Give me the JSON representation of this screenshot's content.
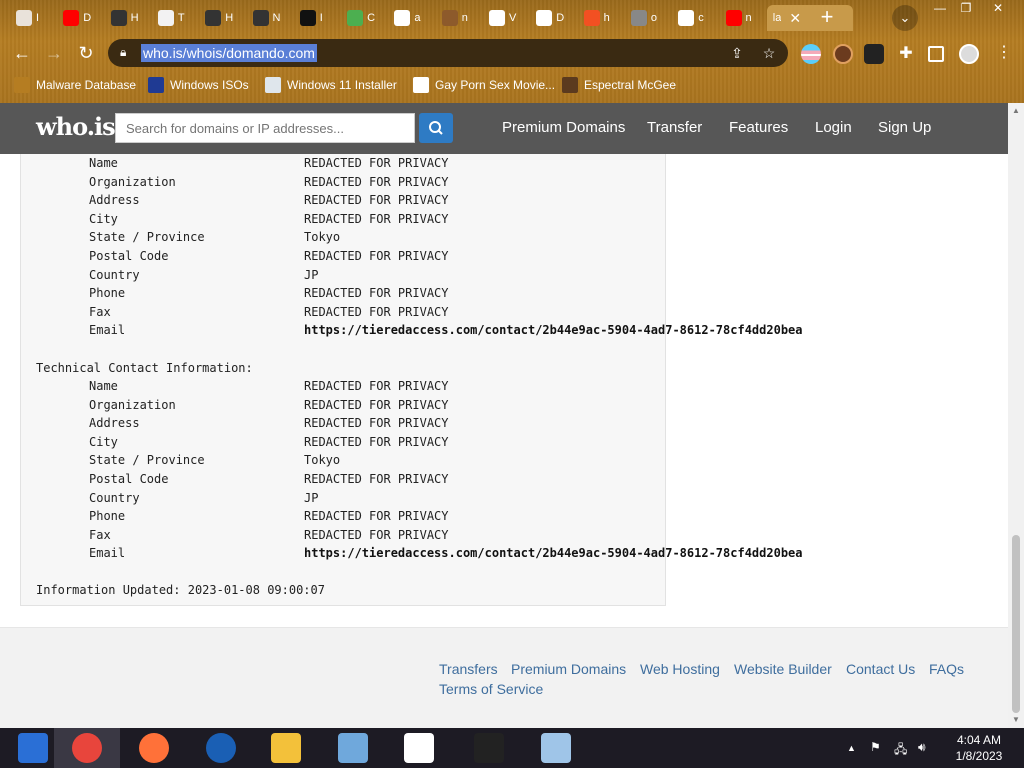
{
  "browser": {
    "tabs": [
      {
        "title": "I",
        "icon": "anime-face-icon",
        "color": "#e9e2da"
      },
      {
        "title": "D",
        "icon": "youtube-icon",
        "color": "#ff0000"
      },
      {
        "title": "H",
        "icon": "glasses-icon",
        "color": "#333333"
      },
      {
        "title": "T",
        "icon": "photo-icon",
        "color": "#f2f2f2"
      },
      {
        "title": "H",
        "icon": "glasses-icon",
        "color": "#333333"
      },
      {
        "title": "N",
        "icon": "glasses-icon",
        "color": "#333333"
      },
      {
        "title": "I",
        "icon": "ip-icon",
        "color": "#111111"
      },
      {
        "title": "C",
        "icon": "pinwheel-icon",
        "color": "#4caf50"
      },
      {
        "title": "a",
        "icon": "globe-icon",
        "color": "#ffffff"
      },
      {
        "title": "n",
        "icon": "monkey-icon",
        "color": "#8d5a2b"
      },
      {
        "title": "V",
        "icon": "museum-icon",
        "color": "#ffffff"
      },
      {
        "title": "D",
        "icon": "v8-icon",
        "color": "#ffffff"
      },
      {
        "title": "h",
        "icon": "microsoft-icon",
        "color": "#f25022"
      },
      {
        "title": "o",
        "icon": "ring-icon",
        "color": "#888888"
      },
      {
        "title": "c",
        "icon": "wikipedia-icon",
        "color": "#ffffff"
      },
      {
        "title": "n",
        "icon": "youtube-icon",
        "color": "#ff0000"
      }
    ],
    "active_tab": {
      "title": "la",
      "icon": "blank-icon"
    },
    "url": "who.is/whois/domando.com",
    "bookmarks": [
      {
        "label": "Malware Database",
        "icon": "bug-icon",
        "color": "#b57d22"
      },
      {
        "label": "Windows ISOs",
        "icon": "x-icon",
        "color": "#1f3a93"
      },
      {
        "label": "Windows 11 Installer",
        "icon": "image-icon",
        "color": "#dfe6ec"
      },
      {
        "label": "Gay Porn Sex Movie...",
        "icon": "python-icon",
        "color": "#ffffff"
      },
      {
        "label": "Espectral McGee",
        "icon": "face-icon",
        "color": "#5b3a1e"
      }
    ],
    "window": {
      "minimize": "—",
      "restore": "❐",
      "close": "✕"
    }
  },
  "site": {
    "logo": "who.is",
    "search_placeholder": "Search for domains or IP addresses...",
    "nav": [
      "Premium Domains",
      "Transfer",
      "Features",
      "Login",
      "Sign Up"
    ],
    "colors": {
      "header": "#575757",
      "accent": "#2e7bc4",
      "link": "#3f6e9e"
    }
  },
  "whois": {
    "registrant_rows": [
      {
        "label": "Name",
        "value": "REDACTED FOR PRIVACY"
      },
      {
        "label": "Organization",
        "value": "REDACTED FOR PRIVACY"
      },
      {
        "label": "Address",
        "value": "REDACTED FOR PRIVACY"
      },
      {
        "label": "City",
        "value": "REDACTED FOR PRIVACY"
      },
      {
        "label": "State / Province",
        "value": "Tokyo"
      },
      {
        "label": "Postal Code",
        "value": "REDACTED FOR PRIVACY"
      },
      {
        "label": "Country",
        "value": "JP"
      },
      {
        "label": "Phone",
        "value": "REDACTED FOR PRIVACY"
      },
      {
        "label": "Fax",
        "value": "REDACTED FOR PRIVACY"
      },
      {
        "label": "Email",
        "value": "https://tieredaccess.com/contact/2b44e9ac-5904-4ad7-8612-78cf4dd20bea"
      }
    ],
    "technical_heading": "Technical Contact Information:",
    "technical_rows": [
      {
        "label": "Name",
        "value": "REDACTED FOR PRIVACY"
      },
      {
        "label": "Organization",
        "value": "REDACTED FOR PRIVACY"
      },
      {
        "label": "Address",
        "value": "REDACTED FOR PRIVACY"
      },
      {
        "label": "City",
        "value": "REDACTED FOR PRIVACY"
      },
      {
        "label": "State / Province",
        "value": "Tokyo"
      },
      {
        "label": "Postal Code",
        "value": "REDACTED FOR PRIVACY"
      },
      {
        "label": "Country",
        "value": "JP"
      },
      {
        "label": "Phone",
        "value": "REDACTED FOR PRIVACY"
      },
      {
        "label": "Fax",
        "value": "REDACTED FOR PRIVACY"
      },
      {
        "label": "Email",
        "value": "https://tieredaccess.com/contact/2b44e9ac-5904-4ad7-8612-78cf4dd20bea"
      }
    ],
    "updated": "Information Updated: 2023-01-08 09:00:07"
  },
  "footer": {
    "links": [
      "Transfers",
      "Premium Domains",
      "Web Hosting",
      "Website Builder",
      "Contact Us",
      "FAQs",
      "Terms of Service"
    ]
  },
  "taskbar": {
    "apps": [
      {
        "name": "sims-icon",
        "color": "#2a6fd6"
      },
      {
        "name": "chrome-icon",
        "color": "#e8453c"
      },
      {
        "name": "firefox-icon",
        "color": "#ff7139"
      },
      {
        "name": "obama-icon",
        "color": "#1a5fb4"
      },
      {
        "name": "file-explorer-icon",
        "color": "#f3c13a"
      },
      {
        "name": "people-icon",
        "color": "#6fa8dc"
      },
      {
        "name": "v8-icon",
        "color": "#ffffff"
      },
      {
        "name": "warning-app-icon",
        "color": "#222222"
      },
      {
        "name": "installer-icon",
        "color": "#9fc5e8"
      }
    ],
    "time": "4:04 AM",
    "date": "1/8/2023"
  }
}
